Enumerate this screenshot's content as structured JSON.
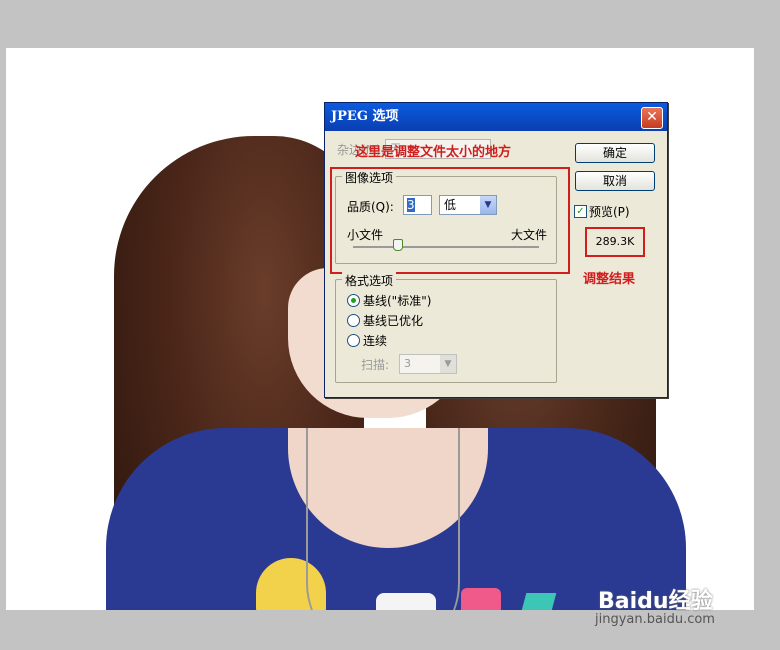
{
  "dialog": {
    "title": "JPEG 选项",
    "close_symbol": "✕",
    "matte_label": "杂边(M):",
    "matte_value": "无",
    "image_options": {
      "group_title": "图像选项",
      "quality_label": "品质(Q):",
      "quality_value": "3",
      "quality_preset": "低",
      "small_file_label": "小文件",
      "large_file_label": "大文件"
    },
    "format_options": {
      "group_title": "格式选项",
      "options": [
        "基线(\"标准\")",
        "基线已优化",
        "连续"
      ],
      "selected_index": 0,
      "scans_label": "扫描:",
      "scans_value": "3"
    },
    "buttons": {
      "ok": "确定",
      "cancel": "取消"
    },
    "preview_label": "预览(P)",
    "preview_checked": true,
    "file_size": "289.3K"
  },
  "annotations": {
    "top_note": "这里是调整文件太小的地方",
    "result_note": "调整结果"
  },
  "watermark": {
    "brand": "Baidu经验",
    "url": "jingyan.baidu.com"
  },
  "colors": {
    "annotation_red": "#d01e1e",
    "titlebar_blue": "#0b5be0"
  }
}
